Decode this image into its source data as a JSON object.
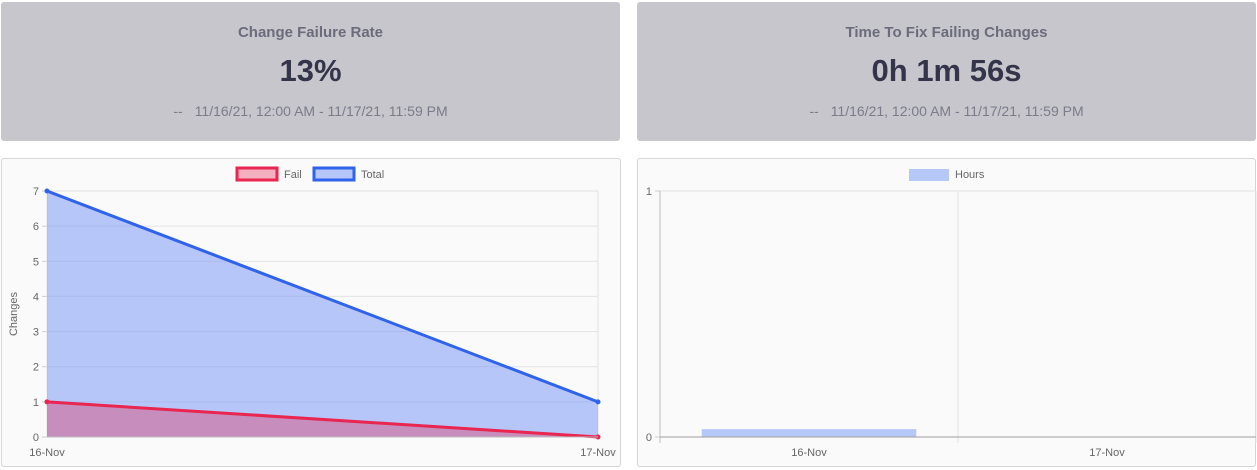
{
  "cards": [
    {
      "title": "Change Failure Rate",
      "value": "13%",
      "dash": "--",
      "range": "11/16/21, 12:00 AM - 11/17/21, 11:59 PM"
    },
    {
      "title": "Time To Fix Failing Changes",
      "value": "0h 1m 56s",
      "dash": "--",
      "range": "11/16/21, 12:00 AM - 11/17/21, 11:59 PM"
    }
  ],
  "colors": {
    "fail": "#e8264f",
    "fail_fill": "rgba(232,38,79,0.35)",
    "total": "#2f63ec",
    "total_fill": "rgba(126,155,245,0.55)",
    "hours_fill": "#b6c8f8"
  },
  "chart_data": [
    {
      "type": "area",
      "categories": [
        "16-Nov",
        "17-Nov"
      ],
      "series": [
        {
          "name": "Fail",
          "values": [
            1,
            0
          ]
        },
        {
          "name": "Total",
          "values": [
            7,
            1
          ]
        }
      ],
      "ylabel": "Changes",
      "ylim": [
        0,
        7
      ],
      "yticks": [
        0,
        1,
        2,
        3,
        4,
        5,
        6,
        7
      ],
      "grid": true,
      "legend": "top-center"
    },
    {
      "type": "bar",
      "categories": [
        "16-Nov",
        "17-Nov"
      ],
      "series": [
        {
          "name": "Hours",
          "values": [
            0.032,
            0
          ]
        }
      ],
      "ylim": [
        0,
        1
      ],
      "yticks": [
        0,
        1
      ],
      "grid": true,
      "legend": "top-center"
    }
  ]
}
